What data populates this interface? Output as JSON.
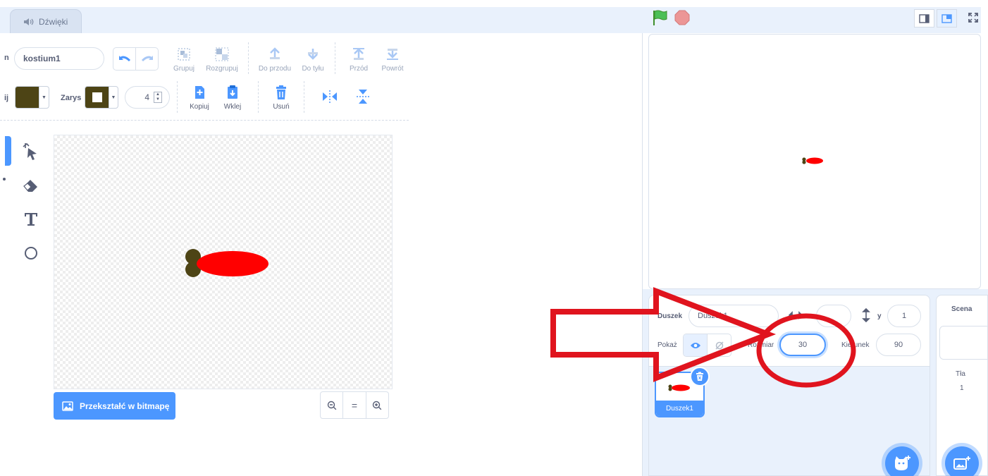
{
  "tabs": {
    "sounds_label": "Dźwięki"
  },
  "costume": {
    "name_label_partial": "n",
    "name_value": "kostium1"
  },
  "toolbar": {
    "group": "Grupuj",
    "ungroup": "Rozgrupuj",
    "forward": "Do przodu",
    "backward": "Do tyłu",
    "front": "Przód",
    "back": "Powrót",
    "fill_label_partial": "ij",
    "outline_label": "Zarys",
    "outline_width": "4",
    "copy": "Kopiuj",
    "paste": "Wklej",
    "delete": "Usuń"
  },
  "canvas": {
    "convert_button": "Przekształć w bitmapę",
    "zoom_reset": "="
  },
  "sprite_info": {
    "sprite_label": "Duszek",
    "sprite_name_value": "Duszek1",
    "x_label": "x",
    "x_value": "",
    "y_label": "y",
    "y_value": "1",
    "show_label": "Pokaż",
    "size_label": "Rozmiar",
    "size_value": "30",
    "direction_label": "Kierunek",
    "direction_value": "90"
  },
  "sprites": [
    {
      "name": "Duszek1"
    }
  ],
  "stage_panel": {
    "title": "Scena",
    "backdrops_label": "Tła",
    "backdrops_count": "1"
  },
  "colors": {
    "accent": "#4c97ff",
    "fill_color": "#4d4415",
    "carrot_body": "#ff0000",
    "annotation": "#e0141e"
  },
  "icons": {
    "speaker": "speaker-icon",
    "flag": "green-flag-icon",
    "stop": "stop-icon"
  }
}
